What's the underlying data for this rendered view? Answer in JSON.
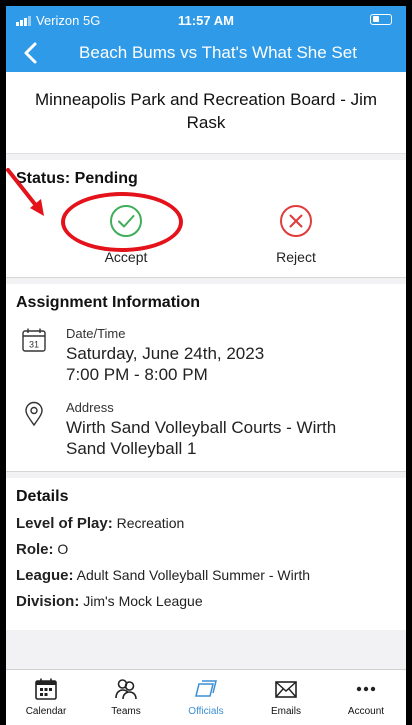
{
  "status_bar": {
    "carrier": "Verizon 5G",
    "time": "11:57 AM"
  },
  "nav": {
    "title": "Beach Bums vs That's What She Set"
  },
  "organization": {
    "name": "Minneapolis Park and Recreation Board - Jim Rask"
  },
  "status": {
    "title": "Status: Pending",
    "accept_label": "Accept",
    "reject_label": "Reject"
  },
  "assignment": {
    "title": "Assignment Information",
    "datetime_label": "Date/Time",
    "calendar_day": "31",
    "date": "Saturday, June 24th, 2023",
    "time": "7:00 PM - 8:00 PM",
    "address_label": "Address",
    "address": "Wirth Sand Volleyball Courts - Wirth Sand Volleyball 1"
  },
  "details": {
    "title": "Details",
    "level_label": "Level of Play:",
    "level_value": "Recreation",
    "role_label": "Role:",
    "role_value": "O",
    "league_label": "League:",
    "league_value": "Adult Sand Volleyball Summer - Wirth",
    "division_label": "Division:",
    "division_value": "Jim's Mock League"
  },
  "tabs": [
    {
      "label": "Calendar",
      "icon": "calendar-icon"
    },
    {
      "label": "Teams",
      "icon": "teams-icon"
    },
    {
      "label": "Officials",
      "icon": "officials-icon",
      "active": true
    },
    {
      "label": "Emails",
      "icon": "email-icon"
    },
    {
      "label": "Account",
      "icon": "more-icon"
    }
  ],
  "colors": {
    "brand": "#2f9be8",
    "accept": "#3fae5a",
    "reject": "#e03c3c",
    "annotation": "#e4121a"
  }
}
